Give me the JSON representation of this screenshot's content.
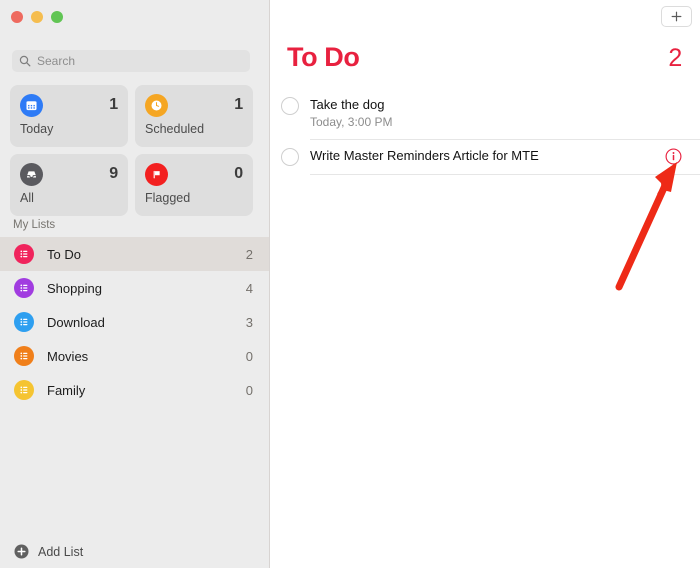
{
  "window": {
    "traffic_lights": [
      {
        "name": "close",
        "color": "#ee6a5f"
      },
      {
        "name": "minimize",
        "color": "#f5bd4f"
      },
      {
        "name": "maximize",
        "color": "#61c554"
      }
    ]
  },
  "sidebar": {
    "search": {
      "icon": "search-icon",
      "placeholder": "Search",
      "value": ""
    },
    "smart_lists": [
      {
        "label": "Today",
        "count": "1",
        "icon": "calendar-icon",
        "color": "#2e7bf6"
      },
      {
        "label": "Scheduled",
        "count": "1",
        "icon": "clock-icon",
        "color": "#f5a623"
      },
      {
        "label": "All",
        "count": "9",
        "icon": "inbox-icon",
        "color": "#5a5a5f"
      },
      {
        "label": "Flagged",
        "count": "0",
        "icon": "flag-icon",
        "color": "#f32020"
      }
    ],
    "section_title": "My Lists",
    "lists": [
      {
        "label": "To Do",
        "count": "2",
        "icon": "list-bullet-icon",
        "color": "#f0245c",
        "selected": true
      },
      {
        "label": "Shopping",
        "count": "4",
        "icon": "list-bullet-icon",
        "color": "#a13ce0",
        "selected": false
      },
      {
        "label": "Download",
        "count": "3",
        "icon": "list-bullet-icon",
        "color": "#2e9ff0",
        "selected": false
      },
      {
        "label": "Movies",
        "count": "0",
        "icon": "list-bullet-icon",
        "color": "#f07f1a",
        "selected": false
      },
      {
        "label": "Family",
        "count": "0",
        "icon": "list-bullet-icon",
        "color": "#f5c431",
        "selected": false
      }
    ],
    "add_list": {
      "label": "Add List",
      "icon": "plus-circle-icon"
    }
  },
  "content": {
    "add_button": {
      "icon": "plus-icon",
      "label": "+"
    },
    "title": "To Do",
    "count": "2",
    "accent_color": "#e8213f",
    "reminders": [
      {
        "title": "Take the dog",
        "subtitle": "Today, 3:00 PM",
        "completed": false,
        "has_info_button": false
      },
      {
        "title": "Write Master Reminders Article for MTE",
        "subtitle": "",
        "completed": false,
        "has_info_button": true
      }
    ]
  },
  "annotation": {
    "arrow": {
      "name": "red-arrow-annotation",
      "color": "#ee2a17",
      "points_to": "info-button"
    }
  }
}
